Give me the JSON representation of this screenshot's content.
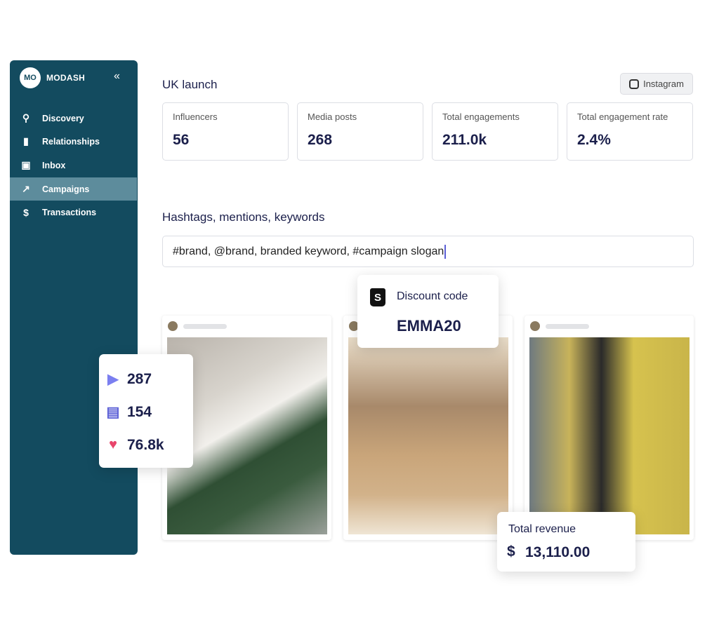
{
  "sidebar": {
    "logo": "MO",
    "brand": "MODASH",
    "collapse_icon": "double-chevron-left-icon",
    "items": [
      {
        "label": "Discovery",
        "icon": "search-icon"
      },
      {
        "label": "Relationships",
        "icon": "bookmarks-icon"
      },
      {
        "label": "Inbox",
        "icon": "inbox-icon"
      },
      {
        "label": "Campaigns",
        "icon": "trending-up-icon",
        "active": true
      },
      {
        "label": "Transactions",
        "icon": "dollar-icon"
      }
    ]
  },
  "header": {
    "title": "UK launch",
    "platform": "Instagram"
  },
  "stats": [
    {
      "label": "Influencers",
      "value": "56"
    },
    {
      "label": "Media posts",
      "value": "268"
    },
    {
      "label": "Total engagements",
      "value": "211.0k"
    },
    {
      "label": "Total engagement rate",
      "value": "2.4%"
    }
  ],
  "tracking": {
    "heading": "Hashtags, mentions, keywords",
    "value": "#brand, @brand, branded keyword, #campaign slogan"
  },
  "post_stats": {
    "plays": "287",
    "comments": "154",
    "likes": "76.8k"
  },
  "discount": {
    "label": "Discount code",
    "code": "EMMA20"
  },
  "revenue": {
    "label": "Total revenue",
    "currency": "$",
    "value": "13,110.00"
  },
  "colors": {
    "sidebar": "#134b5f",
    "active": "#5d8c9c",
    "accent": "#7b7ff0",
    "heart": "#e8456b"
  }
}
